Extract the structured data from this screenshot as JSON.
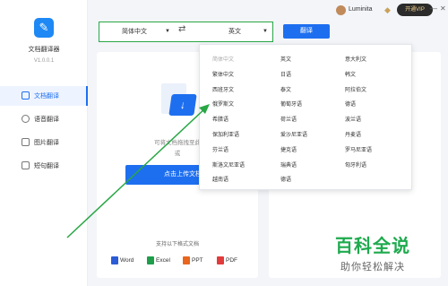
{
  "app": {
    "name": "文档翻译器",
    "version": "V1.0.0.1"
  },
  "sidebar": {
    "items": [
      {
        "label": "文档翻译",
        "active": true
      },
      {
        "label": "语音翻译",
        "active": false
      },
      {
        "label": "图片翻译",
        "active": false
      },
      {
        "label": "短句翻译",
        "active": false
      }
    ]
  },
  "topbar": {
    "user_name": "Luminita",
    "vip_label": "开通VIP",
    "controls": [
      "—",
      "✕"
    ]
  },
  "lang_bar": {
    "source": "简体中文",
    "target": "英文",
    "translate_label": "翻译"
  },
  "upload_panel": {
    "hint_line1": "可将文档拖拽至此",
    "hint_line2": "或",
    "upload_label": "点击上传文档",
    "formats_title": "支持以下格式文档",
    "formats": [
      {
        "label": "Word",
        "color": "#2b5bd6"
      },
      {
        "label": "Excel",
        "color": "#1e9e4b"
      },
      {
        "label": "PPT",
        "color": "#e8661e"
      },
      {
        "label": "PDF",
        "color": "#e23b3b"
      }
    ]
  },
  "language_dropdown": {
    "columns": [
      [
        "简体中文",
        "繁体中文",
        "西班牙文",
        "俄罗斯文",
        "希腊语",
        "保加利亚语",
        "芬兰语",
        "斯洛文尼亚语",
        "越南语"
      ],
      [
        "英文",
        "日语",
        "泰文",
        "葡萄牙语",
        "荷兰语",
        "爱沙尼亚语",
        "捷克语",
        "瑞典语",
        "德语"
      ],
      [
        "意大利文",
        "韩文",
        "阿拉伯文",
        "德语",
        "波兰语",
        "丹麦语",
        "罗马尼亚语",
        "匈牙利语"
      ]
    ]
  },
  "watermark": {
    "title": "百科全说",
    "subtitle": "助你轻松解决"
  },
  "colors": {
    "accent": "#1e6ff0",
    "highlight": "#29a745"
  }
}
